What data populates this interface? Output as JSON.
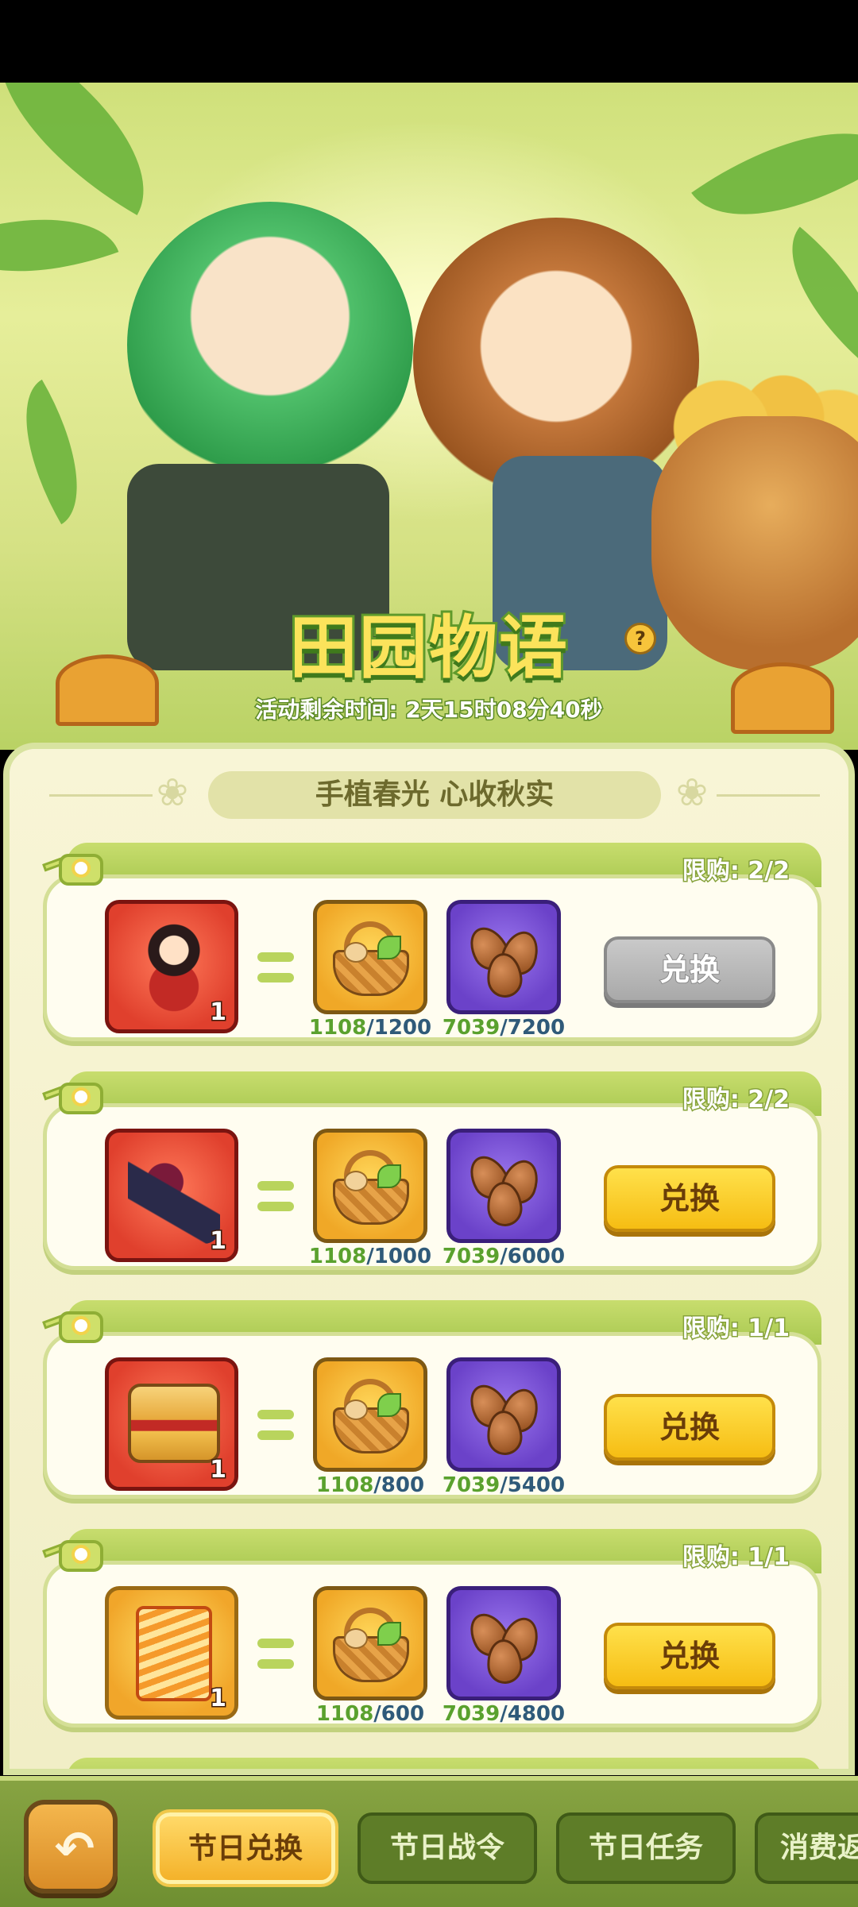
{
  "event": {
    "title": "田园物语",
    "timer_text": "活动剩余时间: 2天15时08分40秒",
    "help_icon": "question-icon"
  },
  "panel": {
    "subtitle": "手植春光 心收秋实"
  },
  "exchange_items": [
    {
      "reward": "pirate-character-portrait",
      "qty": "1",
      "limit": "限购: 2/2",
      "basket_have": "1108",
      "basket_need": "/1200",
      "seed_have": "7039",
      "seed_need": "/7200",
      "button": "兑换",
      "enabled": false
    },
    {
      "reward": "blaster-weapon",
      "qty": "1",
      "limit": "限购: 2/2",
      "basket_have": "1108",
      "basket_need": "/1000",
      "seed_have": "7039",
      "seed_need": "/6000",
      "button": "兑换",
      "enabled": true
    },
    {
      "reward": "treasure-chest",
      "qty": "1",
      "limit": "限购: 1/1",
      "basket_have": "1108",
      "basket_need": "/800",
      "seed_have": "7039",
      "seed_need": "/5400",
      "button": "兑换",
      "enabled": true
    },
    {
      "reward": "tornado-card",
      "qty": "1",
      "limit": "限购: 1/1",
      "basket_have": "1108",
      "basket_need": "/600",
      "seed_have": "7039",
      "seed_need": "/4800",
      "button": "兑换",
      "enabled": true
    }
  ],
  "tabs": [
    {
      "label": "节日兑换",
      "active": true
    },
    {
      "label": "节日战令",
      "active": false
    },
    {
      "label": "节日任务",
      "active": false
    },
    {
      "label": "消费返",
      "active": false
    }
  ],
  "colors": {
    "accent_yellow": "#f6bd13",
    "panel_bg": "#f3f0cc",
    "bottom_bar": "#7a9a38",
    "have_green": "#5aa12e",
    "need_blue": "#2f5a79"
  }
}
